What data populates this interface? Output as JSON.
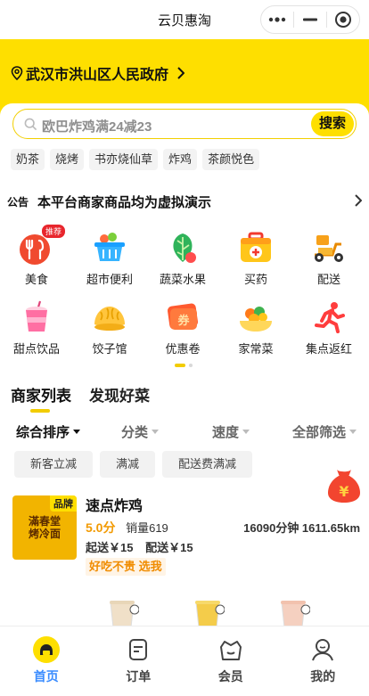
{
  "window": {
    "title": "云贝惠淘"
  },
  "location": {
    "text": "武汉市洪山区人民政府"
  },
  "search": {
    "placeholder": "欧巴炸鸡满24减23",
    "button": "搜索"
  },
  "hot_tags": [
    "奶茶",
    "烧烤",
    "书亦烧仙草",
    "炸鸡",
    "茶颜悦色"
  ],
  "notice": {
    "tag": "公告",
    "text": "本平台商家商品均为虚拟演示"
  },
  "categories": [
    {
      "label": "美食",
      "icon": "food-icon",
      "badge": "推荐"
    },
    {
      "label": "超市便利",
      "icon": "supermarket-basket-icon"
    },
    {
      "label": "蔬菜水果",
      "icon": "vegetable-icon"
    },
    {
      "label": "买药",
      "icon": "medicine-box-icon"
    },
    {
      "label": "配送",
      "icon": "delivery-scooter-icon"
    },
    {
      "label": "甜点饮品",
      "icon": "drink-cup-icon"
    },
    {
      "label": "饺子馆",
      "icon": "dumpling-icon"
    },
    {
      "label": "优惠卷",
      "icon": "coupon-icon"
    },
    {
      "label": "家常菜",
      "icon": "home-dish-icon"
    },
    {
      "label": "集点返红",
      "icon": "running-man-icon"
    }
  ],
  "section_tabs": [
    "商家列表",
    "发现好菜"
  ],
  "filters": [
    {
      "label": "综合排序",
      "active": true
    },
    {
      "label": "分类",
      "active": false
    },
    {
      "label": "速度",
      "active": false
    },
    {
      "label": "全部筛选",
      "active": false
    }
  ],
  "chips": [
    "新客立减",
    "满减",
    "配送费满减"
  ],
  "shop": {
    "brand_tag": "品牌",
    "logo_text": "滿春堂\n烤冷面",
    "name": "速点炸鸡",
    "score": "5.0分",
    "sales": "销量619",
    "time_distance": "16090分钟 1611.65km",
    "min_order": "起送￥15",
    "delivery": "配送￥15",
    "promo": "好吃不贵 选我"
  },
  "tabbar": [
    {
      "label": "首页",
      "icon": "home-icon",
      "active": true
    },
    {
      "label": "订单",
      "icon": "order-icon",
      "active": false
    },
    {
      "label": "会员",
      "icon": "member-icon",
      "active": false
    },
    {
      "label": "我的",
      "icon": "profile-icon",
      "active": false
    }
  ],
  "colors": {
    "brand": "#fedf00",
    "active_tab": "#3a8cff",
    "score": "#f29a02",
    "badge": "#e8262d"
  }
}
